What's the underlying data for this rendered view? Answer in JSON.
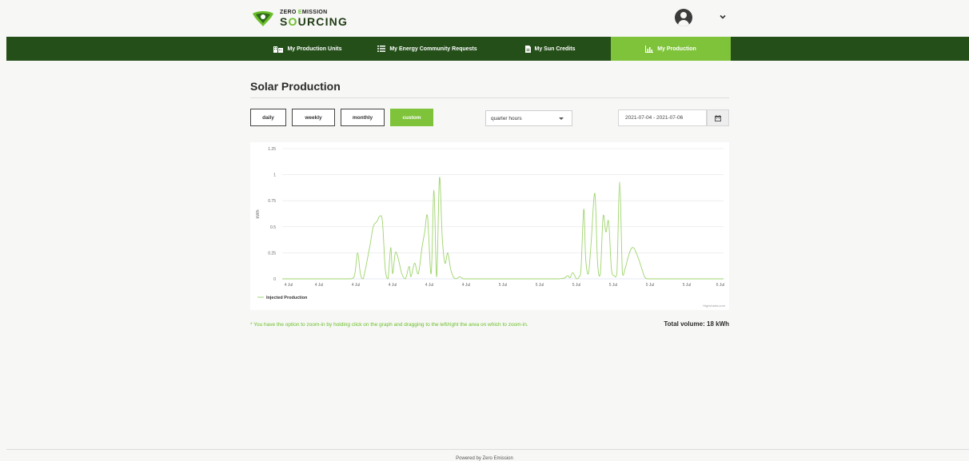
{
  "brand": {
    "line1_prefix": "ZERO ",
    "line1_accent": "E",
    "line1_rest": "MISSION",
    "line2_prefix": "S",
    "line2_accent": "O",
    "line2_rest": "URCING"
  },
  "colors": {
    "nav_bg": "#244f19",
    "accent": "#7ec33a",
    "series": "#9ed46b"
  },
  "user": {
    "avatar_icon": "user-circle-icon",
    "menu_icon": "chevron-down-icon"
  },
  "nav": {
    "items": [
      {
        "label": "My Production Units",
        "icon": "building-icon"
      },
      {
        "label": "My Energy Community Requests",
        "icon": "list-icon"
      },
      {
        "label": "My Sun Credits",
        "icon": "document-icon"
      },
      {
        "label": "My Production",
        "icon": "bar-chart-icon",
        "active": true
      }
    ]
  },
  "page": {
    "title": "Solar Production"
  },
  "controls": {
    "period_buttons": [
      "daily",
      "weekly",
      "monthly",
      "custom"
    ],
    "active_period": "custom",
    "granularity": "quarter hours",
    "date_range": "2021-07-04 - 2021-07-06",
    "calendar_icon": "calendar-icon"
  },
  "chart_data": {
    "type": "line",
    "ylabel": "kWh",
    "ylim": [
      0,
      1.25
    ],
    "yticks": [
      "0",
      "0.25",
      "0.5",
      "0.75",
      "1",
      "1.25"
    ],
    "xticks": [
      "4 Jul",
      "4 Jul",
      "4 Jul",
      "4 Jul",
      "4 Jul",
      "4 Jul",
      "5 Jul",
      "5 Jul",
      "5 Jul",
      "5 Jul",
      "5 Jul",
      "5 Jul",
      "6 Jul"
    ],
    "grid": true,
    "legend": "bottom-left",
    "credit": "Highcharts.com",
    "series": [
      {
        "name": "Injected Production",
        "x": [
          0,
          6,
          7.5,
          7.9,
          8.2,
          8.5,
          8.8,
          9.5,
          9.9,
          10.3,
          10.6,
          10.9,
          11.2,
          11.5,
          11.8,
          12.0,
          12.3,
          12.6,
          13.0,
          13.4,
          13.8,
          14.0,
          14.4,
          14.8,
          15.2,
          15.5,
          15.8,
          16.2,
          16.5,
          16.8,
          17.1,
          17.4,
          17.7,
          18.0,
          18.3,
          18.6,
          18.9,
          19.3,
          19.7,
          20.2,
          21.0,
          22.0,
          24,
          30,
          31.0,
          31.3,
          31.6,
          32.0,
          32.3,
          32.5,
          32.8,
          33.0,
          33.3,
          33.6,
          34.0,
          34.3,
          34.6,
          34.9,
          35.2,
          35.5,
          35.8,
          36.1,
          36.4,
          36.7,
          37.0,
          37.3,
          37.6,
          37.9,
          38.2,
          38.5,
          38.8,
          39.1,
          39.4,
          39.7,
          40.0,
          40.3,
          40.6,
          40.9,
          41.3,
          41.7,
          42.1,
          42.5,
          43.0,
          44.0,
          48
        ],
        "values": [
          0,
          0,
          0,
          0.05,
          0.25,
          0.05,
          0,
          0.3,
          0.5,
          0.55,
          0.6,
          0.55,
          0.1,
          0,
          0.3,
          0.05,
          0.25,
          0.2,
          0.05,
          0,
          0.12,
          0.02,
          0.15,
          0.05,
          0.3,
          0.45,
          0.6,
          0.05,
          0.85,
          0.02,
          0.97,
          0.4,
          0.15,
          0.25,
          0.1,
          0.02,
          0,
          0.02,
          0,
          0,
          0,
          0,
          0,
          0,
          0.03,
          0.01,
          0.06,
          0,
          0.02,
          0.1,
          0.67,
          0.2,
          0.05,
          0.35,
          0.82,
          0.15,
          0.05,
          0.6,
          0.45,
          0.55,
          0.1,
          0.03,
          0.05,
          0.93,
          0.05,
          0.1,
          0.2,
          0.28,
          0.3,
          0.25,
          0.18,
          0.1,
          0.02,
          0,
          0,
          0,
          0,
          0,
          0,
          0,
          0,
          0,
          0,
          0,
          0
        ]
      }
    ]
  },
  "note": "* You have the option to zoom-in by holding click on the graph and dragging to the left/right the area on which to zoom-in.",
  "total": "Total volume: 18 kWh",
  "footer": "Powered by Zero Emission"
}
